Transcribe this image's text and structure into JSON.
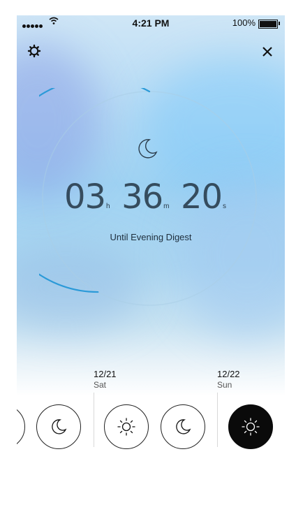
{
  "status_bar": {
    "time": "4:21 PM",
    "battery": "100%"
  },
  "countdown": {
    "hours": "03",
    "hours_unit": "h",
    "minutes": "36",
    "minutes_unit": "m",
    "seconds": "20",
    "seconds_unit": "s",
    "caption": "Until Evening Digest",
    "progress": 0.42
  },
  "schedule": {
    "days": [
      {
        "date": "12/21",
        "day": "Sat"
      },
      {
        "date": "12/22",
        "day": "Sun"
      }
    ]
  },
  "colors": {
    "accent": "#2b9ad8",
    "ring_track": "#b8d4e8",
    "active_button": "#0a0a0a"
  },
  "icons": [
    "gear-icon",
    "close-icon",
    "moon-icon",
    "sun-icon",
    "wifi-icon"
  ]
}
